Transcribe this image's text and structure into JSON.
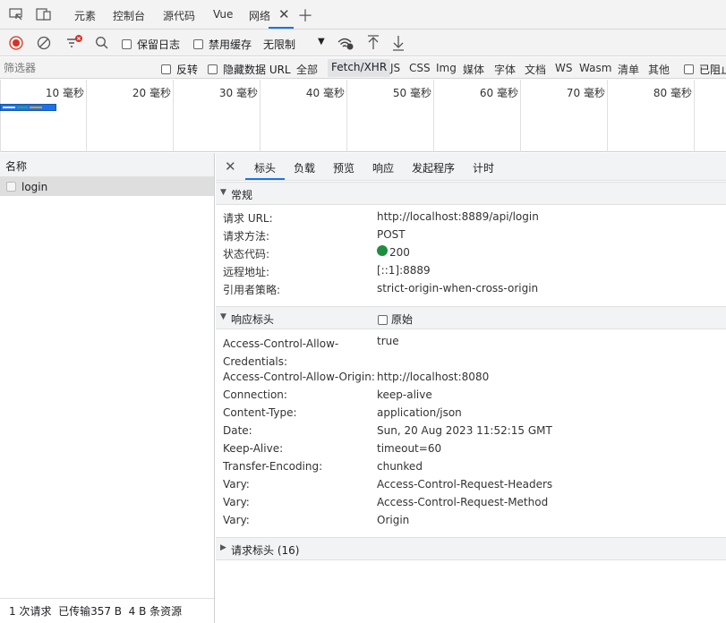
{
  "top_tabs": [
    "元素",
    "控制台",
    "源代码",
    "Vue",
    "网络"
  ],
  "toolbar": {
    "preserve_log": "保留日志",
    "disable_cache": "禁用缓存",
    "throttling": "无限制"
  },
  "filter": {
    "placeholder": "筛选器",
    "invert": "反转",
    "hide_data_urls": "隐藏数据 URL",
    "all": "全部",
    "types": [
      "Fetch/XHR",
      "JS",
      "CSS",
      "Img",
      "媒体",
      "字体",
      "文档",
      "WS",
      "Wasm",
      "清单",
      "其他"
    ],
    "blocked": "已阻止"
  },
  "timeline": {
    "ticks": [
      "10 毫秒",
      "20 毫秒",
      "30 毫秒",
      "40 毫秒",
      "50 毫秒",
      "60 毫秒",
      "70 毫秒",
      "80 毫秒"
    ]
  },
  "request_list": {
    "header": "名称",
    "items": [
      "login"
    ],
    "footer": "1 次请求  已传输357 B  4 B 条资源"
  },
  "detail_tabs": [
    "标头",
    "负载",
    "预览",
    "响应",
    "发起程序",
    "计时"
  ],
  "general": {
    "title": "常规",
    "rows": [
      {
        "k": "请求 URL:",
        "v": "http://localhost:8889/api/login"
      },
      {
        "k": "请求方法:",
        "v": "POST"
      },
      {
        "k": "状态代码:",
        "v": "200"
      },
      {
        "k": "远程地址:",
        "v": "[::1]:8889"
      },
      {
        "k": "引用者策略:",
        "v": "strict-origin-when-cross-origin"
      }
    ]
  },
  "response_headers": {
    "title": "响应标头",
    "raw": "原始",
    "rows": [
      {
        "k": "Access-Control-Allow-Credentials:",
        "v": "true"
      },
      {
        "k": "Access-Control-Allow-Origin:",
        "v": "http://localhost:8080"
      },
      {
        "k": "Connection:",
        "v": "keep-alive"
      },
      {
        "k": "Content-Type:",
        "v": "application/json"
      },
      {
        "k": "Date:",
        "v": "Sun, 20 Aug 2023 11:52:15 GMT"
      },
      {
        "k": "Keep-Alive:",
        "v": "timeout=60"
      },
      {
        "k": "Transfer-Encoding:",
        "v": "chunked"
      },
      {
        "k": "Vary:",
        "v": "Access-Control-Request-Headers"
      },
      {
        "k": "Vary:",
        "v": "Access-Control-Request-Method"
      },
      {
        "k": "Vary:",
        "v": "Origin"
      }
    ]
  },
  "request_headers": {
    "title": "请求标头 (16)"
  },
  "colors": {
    "accent": "#1a73e8",
    "status_ok": "#1e8e3e",
    "record": "#d93025"
  }
}
